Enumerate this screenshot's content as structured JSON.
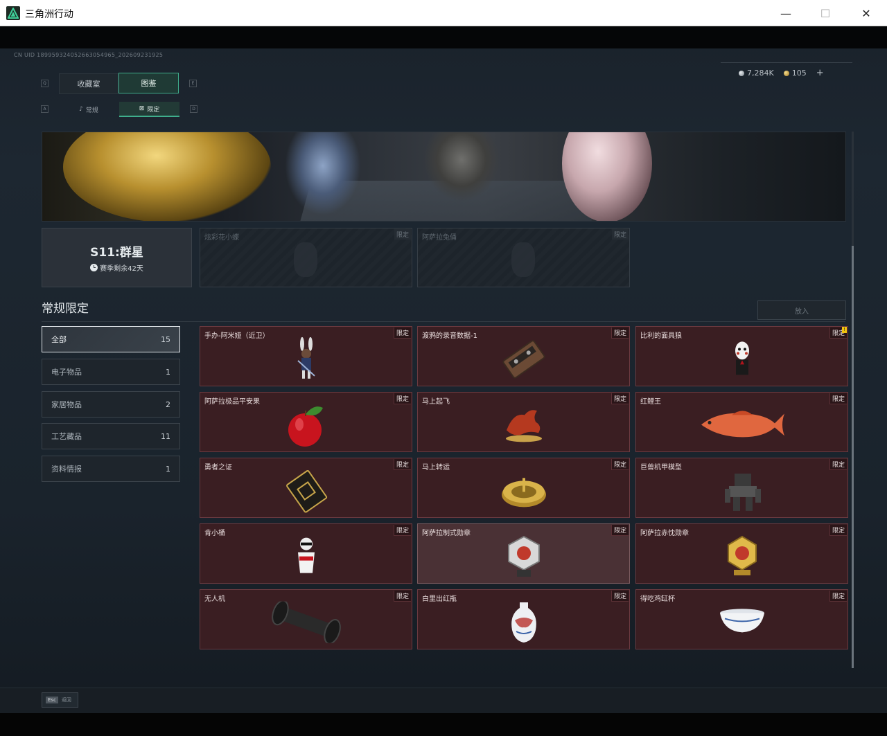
{
  "window": {
    "title": "三角洲行动",
    "minimize": "—",
    "maximize": "☐",
    "close": "✕"
  },
  "uid": "CN UID 1899593240526630549​65_202609231925",
  "currency": {
    "silver": "7,284K",
    "gold": "105",
    "add": "+"
  },
  "key_hints": {
    "q": "Q",
    "e": "E",
    "a": "A",
    "d": "D"
  },
  "tabs": [
    {
      "label": "收藏室"
    },
    {
      "label": "图鉴"
    }
  ],
  "subtabs": [
    {
      "label": "常规",
      "icon": "♪"
    },
    {
      "label": "限定",
      "icon": "⊠"
    }
  ],
  "season": {
    "title": "S11:群星",
    "remaining": "赛季剩余42天"
  },
  "showcase": [
    {
      "name": "炫彩花小蝶",
      "tag": "限定"
    },
    {
      "name": "阿萨拉兔俑",
      "tag": "限定"
    }
  ],
  "section": {
    "title": "常规限定",
    "put_button": "放入"
  },
  "categories": [
    {
      "label": "全部",
      "count": "15"
    },
    {
      "label": "电子物品",
      "count": "1"
    },
    {
      "label": "家居物品",
      "count": "2"
    },
    {
      "label": "工艺藏品",
      "count": "11"
    },
    {
      "label": "资料情报",
      "count": "1"
    }
  ],
  "items": [
    {
      "name": "手办-阿米娅（近卫）",
      "tag": "限定",
      "icon": "figurine-icon"
    },
    {
      "name": "渡鸦的录音数据-1",
      "tag": "限定",
      "icon": "cassette-icon"
    },
    {
      "name": "比利的面具狼",
      "tag": "限定",
      "icon": "puppet-icon",
      "alert": "!"
    },
    {
      "name": "阿萨拉极品平安果",
      "tag": "限定",
      "icon": "apple-icon"
    },
    {
      "name": "马上起飞",
      "tag": "限定",
      "icon": "horse-icon"
    },
    {
      "name": "红鲤王",
      "tag": "限定",
      "icon": "carp-icon"
    },
    {
      "name": "勇者之证",
      "tag": "限定",
      "icon": "card-icon"
    },
    {
      "name": "马上转运",
      "tag": "限定",
      "icon": "dial-icon"
    },
    {
      "name": "巨兽机甲模型",
      "tag": "限定",
      "icon": "mech-icon"
    },
    {
      "name": "肯小桶",
      "tag": "限定",
      "icon": "bucket-figure-icon"
    },
    {
      "name": "阿萨拉制式勋章",
      "tag": "限定",
      "icon": "medal-silver-icon"
    },
    {
      "name": "阿萨拉赤忱勋章",
      "tag": "限定",
      "icon": "medal-gold-icon"
    },
    {
      "name": "无人机",
      "tag": "限定",
      "icon": "drone-icon"
    },
    {
      "name": "白里出红瓶",
      "tag": "限定",
      "icon": "vase-icon"
    },
    {
      "name": "得吃鸡缸杯",
      "tag": "限定",
      "icon": "bowl-icon"
    }
  ],
  "footer": {
    "esc_key": "Esc",
    "back": "返回"
  },
  "colors": {
    "accent": "#3fae8c",
    "item_bg": "#3a1e22",
    "item_border": "#6b3a40"
  }
}
